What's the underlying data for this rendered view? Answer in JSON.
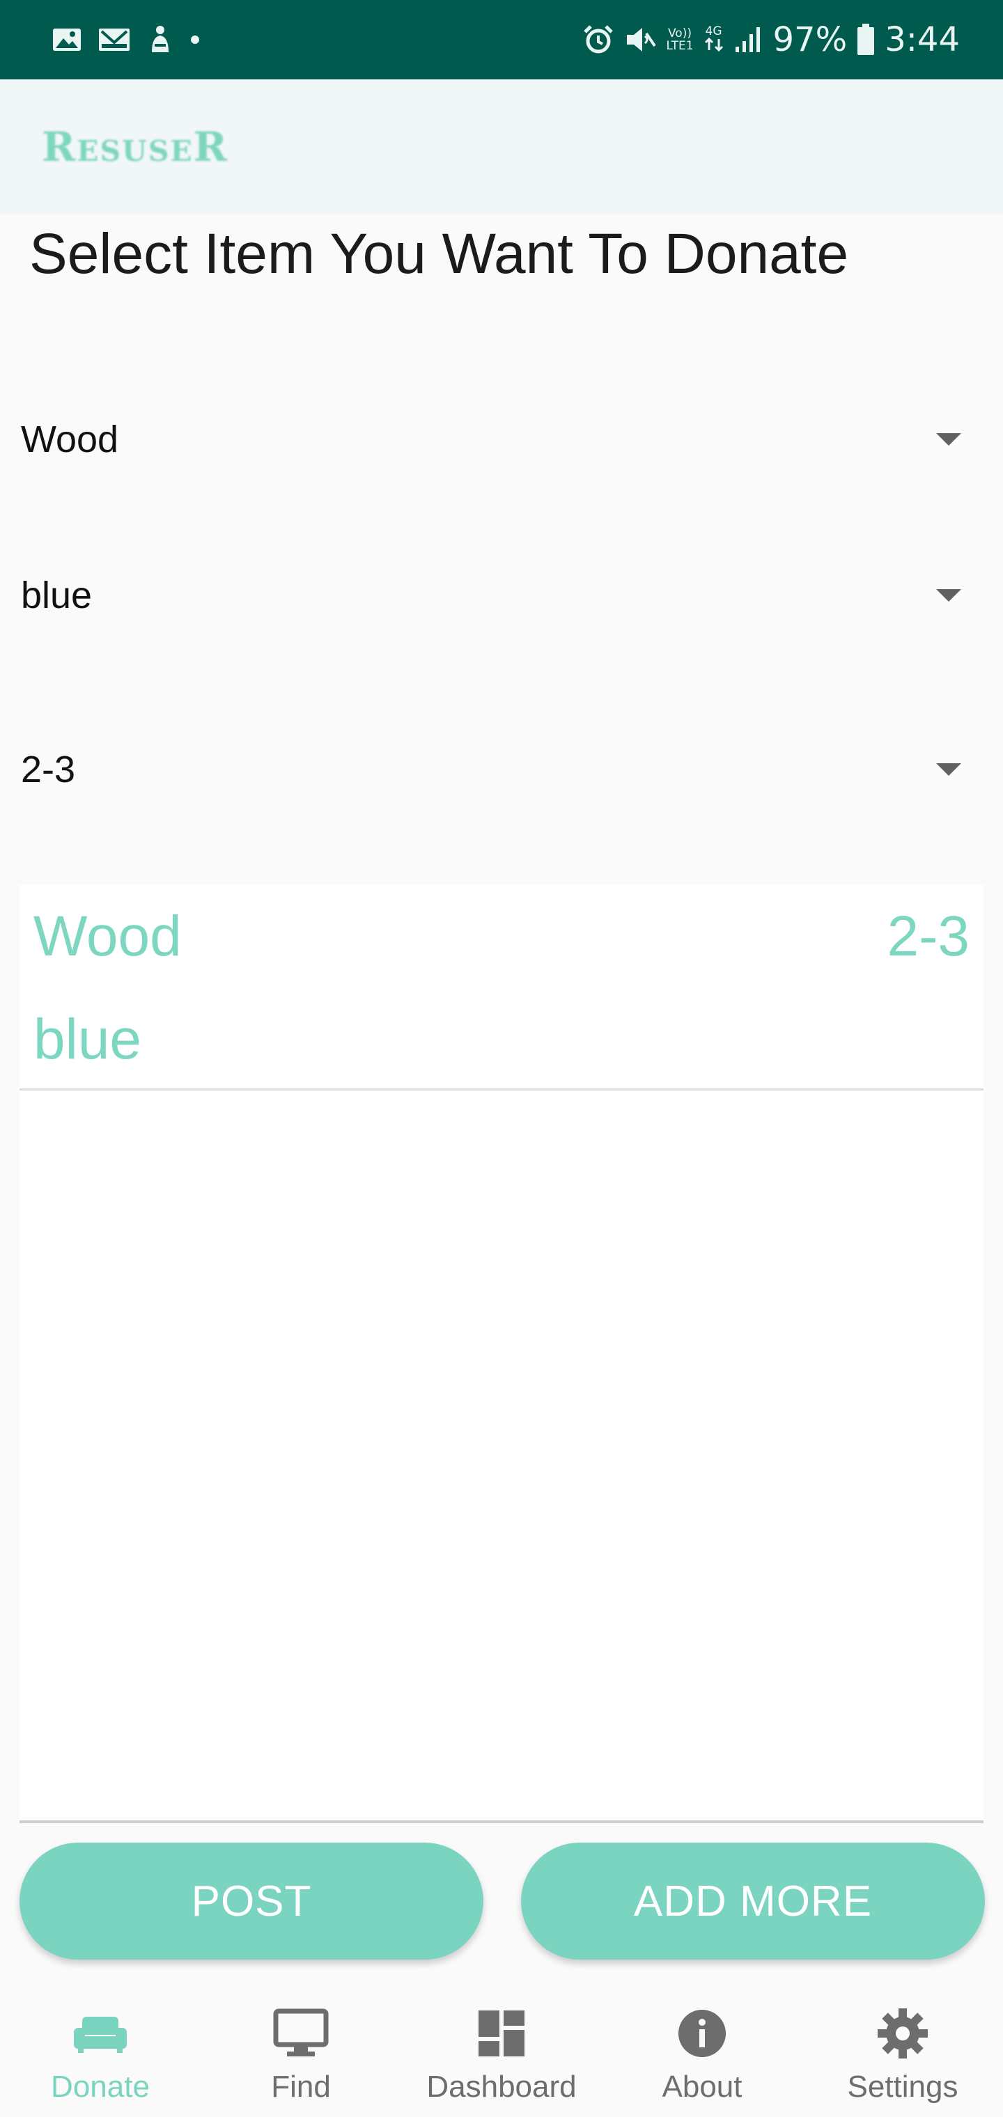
{
  "status_bar": {
    "battery_percent": "97%",
    "time": "3:44",
    "volte_label_top": "Vo))",
    "volte_label_bottom": "LTE1",
    "network_label": "4G"
  },
  "app_bar": {
    "logo_text": "ResuseR"
  },
  "page": {
    "title": "Select Item You Want To Donate"
  },
  "spinners": {
    "material": "Wood",
    "color": "blue",
    "quantity": "2-3"
  },
  "items": [
    {
      "name": "Wood",
      "color": "blue",
      "size": "2-3"
    }
  ],
  "buttons": {
    "post_label": "POST",
    "add_more_label": "ADD MORE"
  },
  "bottom_nav": {
    "items": [
      {
        "label": "Donate",
        "icon": "sofa-icon",
        "active": true
      },
      {
        "label": "Find",
        "icon": "monitor-icon",
        "active": false
      },
      {
        "label": "Dashboard",
        "icon": "dashboard-icon",
        "active": false
      },
      {
        "label": "About",
        "icon": "info-icon",
        "active": false
      },
      {
        "label": "Settings",
        "icon": "gear-icon",
        "active": false
      }
    ]
  },
  "colors": {
    "status_bar": "#005a4e",
    "accent": "#7ad4bf",
    "inactive_icon": "#6d6d6d"
  }
}
